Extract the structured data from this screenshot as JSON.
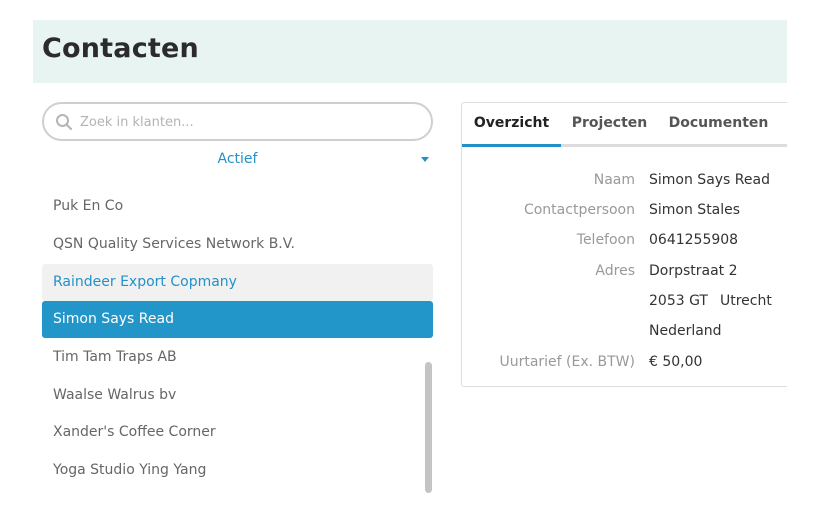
{
  "header": {
    "title": "Contacten"
  },
  "search": {
    "placeholder": "Zoek in klanten...",
    "value": ""
  },
  "filter": {
    "selected": "Actief"
  },
  "contacts": [
    {
      "name": "Puk En Co",
      "state": "normal"
    },
    {
      "name": "QSN Quality Services Network B.V.",
      "state": "normal"
    },
    {
      "name": "Raindeer Export Copmany",
      "state": "hover"
    },
    {
      "name": "Simon Says Read",
      "state": "selected"
    },
    {
      "name": "Tim Tam Traps AB",
      "state": "normal"
    },
    {
      "name": "Waalse Walrus bv",
      "state": "normal"
    },
    {
      "name": "Xander's Coffee Corner",
      "state": "normal"
    },
    {
      "name": "Yoga Studio Ying Yang",
      "state": "normal"
    }
  ],
  "tabs": [
    {
      "label": "Overzicht",
      "active": true
    },
    {
      "label": "Projecten",
      "active": false
    },
    {
      "label": "Documenten",
      "active": false
    }
  ],
  "details": {
    "naam": {
      "label": "Naam",
      "value": "Simon Says Read"
    },
    "contactpersoon": {
      "label": "Contactpersoon",
      "value": "Simon Stales"
    },
    "telefoon": {
      "label": "Telefoon",
      "value": "0641255908"
    },
    "adres": {
      "label": "Adres",
      "street": "Dorpstraat 2",
      "postcode": "2053 GT",
      "city": "Utrecht",
      "country": "Nederland"
    },
    "uurtarief": {
      "label": "Uurtarief (Ex. BTW)",
      "value": "€ 50,00"
    }
  },
  "colors": {
    "accent": "#2391c8",
    "header_bg": "#e8f4f1",
    "selected_bg": "#2396c9",
    "hover_bg": "#f1f1f1"
  },
  "icons": {
    "search": "search-icon",
    "dropdown": "caret-down-icon"
  }
}
